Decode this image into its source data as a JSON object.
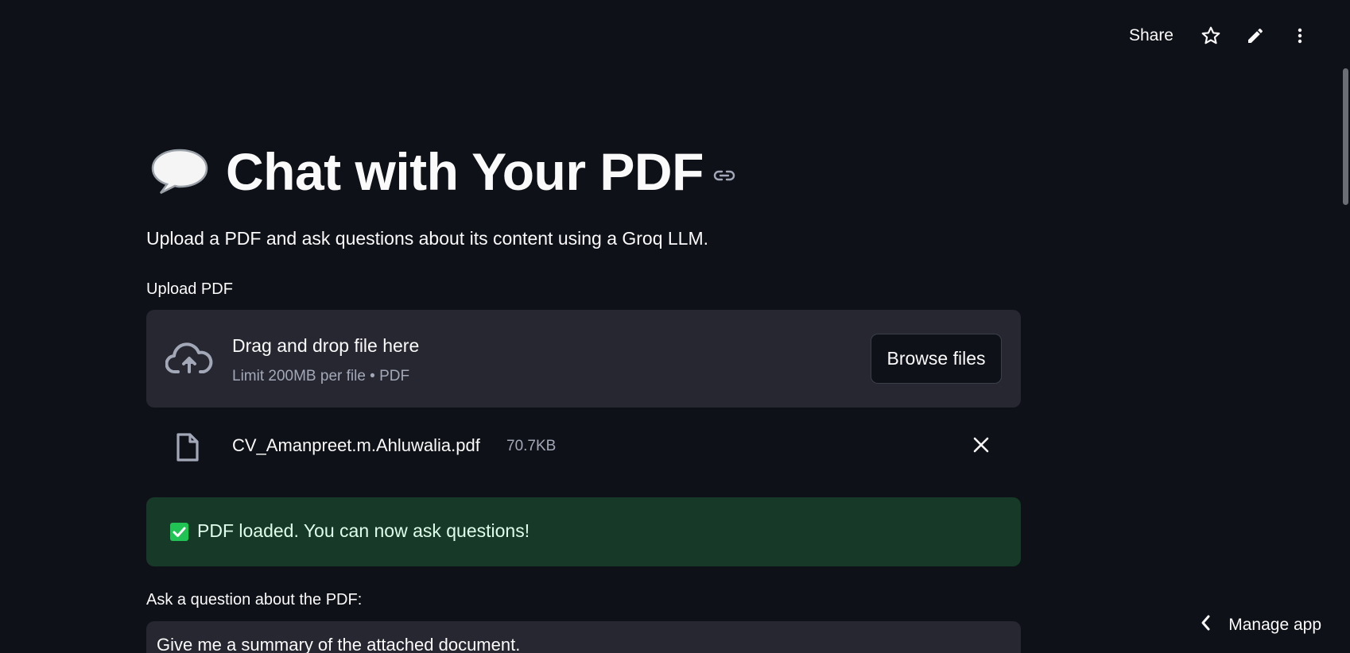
{
  "toolbar": {
    "share_label": "Share",
    "icons": [
      "star-icon",
      "pencil-icon",
      "more-vertical-icon"
    ]
  },
  "header": {
    "emoji_icon": "speech-balloon-icon",
    "title": "Chat with Your PDF",
    "anchor_icon": "link-icon",
    "subtitle": "Upload a PDF and ask questions about its content using a Groq LLM."
  },
  "uploader": {
    "label": "Upload PDF",
    "drop_text": "Drag and drop file here",
    "limit_text": "Limit 200MB per file • PDF",
    "browse_label": "Browse files",
    "icon": "cloud-upload-icon"
  },
  "uploaded_file": {
    "name": "CV_Amanpreet.m.Ahluwalia.pdf",
    "size": "70.7KB",
    "icon": "file-icon",
    "remove_icon": "close-icon"
  },
  "status": {
    "message": "PDF loaded. You can now ask questions!",
    "icon": "check-box-icon",
    "color": "#21c354"
  },
  "question": {
    "label": "Ask a question about the PDF:",
    "value": "Give me a summary of the attached document."
  },
  "footer": {
    "manage_label": "Manage app",
    "icon": "chevron-left-icon"
  },
  "colors": {
    "background": "#0e1117",
    "panel": "#262730",
    "success_bg": "#173928",
    "text": "#fafafa",
    "muted": "#a3a8b8"
  }
}
